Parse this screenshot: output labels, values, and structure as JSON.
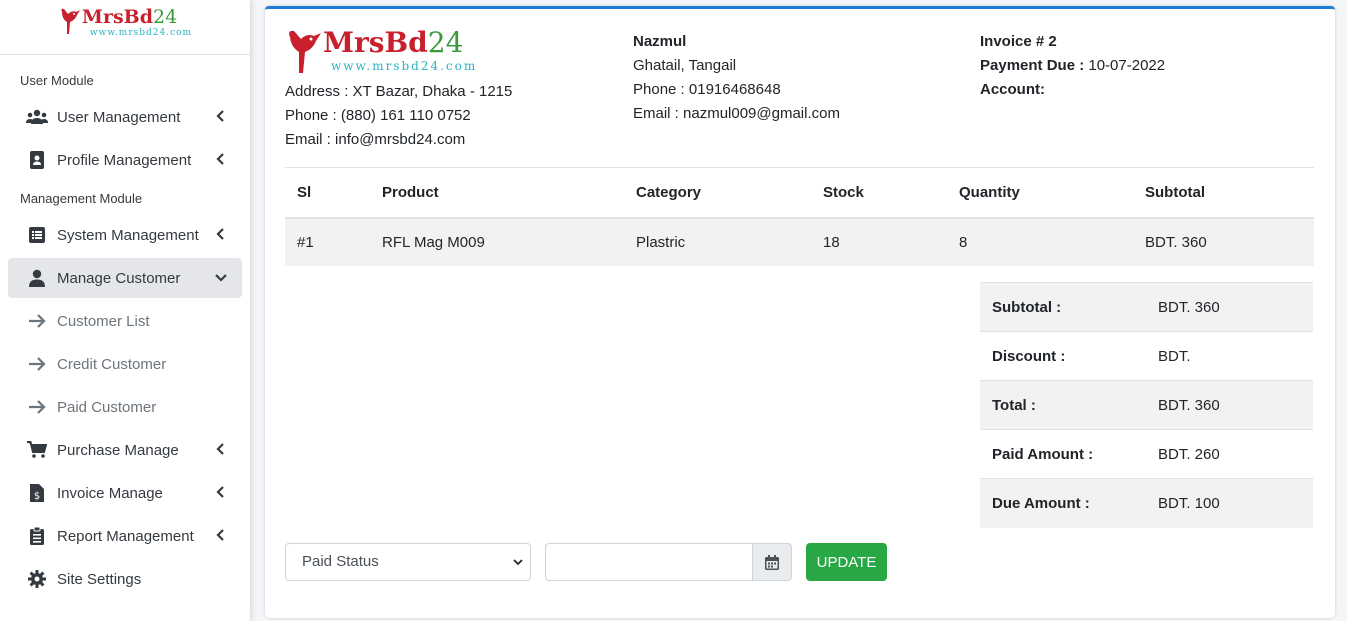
{
  "brand": {
    "name_text": "MrsBd",
    "name_num": "24",
    "url": "www.mrsbd24.com"
  },
  "sidebar": {
    "section1": "User Module",
    "section2": "Management Module",
    "items": [
      {
        "label": "User Management",
        "icon": "users-icon"
      },
      {
        "label": "Profile Management",
        "icon": "id-badge-icon"
      },
      {
        "label": "System Management",
        "icon": "list-icon"
      },
      {
        "label": "Manage Customer",
        "icon": "user-icon"
      },
      {
        "label": "Customer List",
        "icon": "arrow-right-icon"
      },
      {
        "label": "Credit Customer",
        "icon": "arrow-right-icon"
      },
      {
        "label": "Paid Customer",
        "icon": "arrow-right-icon"
      },
      {
        "label": "Purchase Manage",
        "icon": "cart-icon"
      },
      {
        "label": "Invoice Manage",
        "icon": "invoice-icon"
      },
      {
        "label": "Report Management",
        "icon": "clipboard-list-icon"
      },
      {
        "label": "Site Settings",
        "icon": "gear-icon"
      }
    ]
  },
  "company": {
    "address_label": "Address : ",
    "address": "XT Bazar, Dhaka - 1215",
    "phone_label": "Phone : ",
    "phone": "(880) 161 110 0752",
    "email_label": "Email : ",
    "email": "info@mrsbd24.com"
  },
  "customer": {
    "name": "Nazmul",
    "location": "Ghatail, Tangail",
    "phone_label": "Phone : ",
    "phone": "01916468648",
    "email_label": "Email : ",
    "email": "nazmul009@gmail.com"
  },
  "invoice": {
    "number_label": "Invoice # 2",
    "due_label": "Payment Due : ",
    "due_date": "10-07-2022",
    "account_label": "Account:"
  },
  "items_table": {
    "headers": [
      "Sl",
      "Product",
      "Category",
      "Stock",
      "Quantity",
      "Subtotal"
    ],
    "rows": [
      [
        "#1",
        "RFL Mag M009",
        "Plastric",
        "18",
        "8",
        "BDT. 360"
      ]
    ]
  },
  "totals": [
    {
      "label": "Subtotal :",
      "value": "BDT. 360"
    },
    {
      "label": "Discount :",
      "value": "BDT."
    },
    {
      "label": "Total :",
      "value": "BDT. 360"
    },
    {
      "label": "Paid Amount :",
      "value": "BDT. 260"
    },
    {
      "label": "Due Amount :",
      "value": "BDT. 100"
    }
  ],
  "form": {
    "status_selected": "Paid Status",
    "update_label": "UPDATE"
  },
  "colors": {
    "accent": "#1e7bd6",
    "success": "#28a745",
    "brand_red": "#c8202c",
    "brand_green": "#3a9b3a"
  }
}
